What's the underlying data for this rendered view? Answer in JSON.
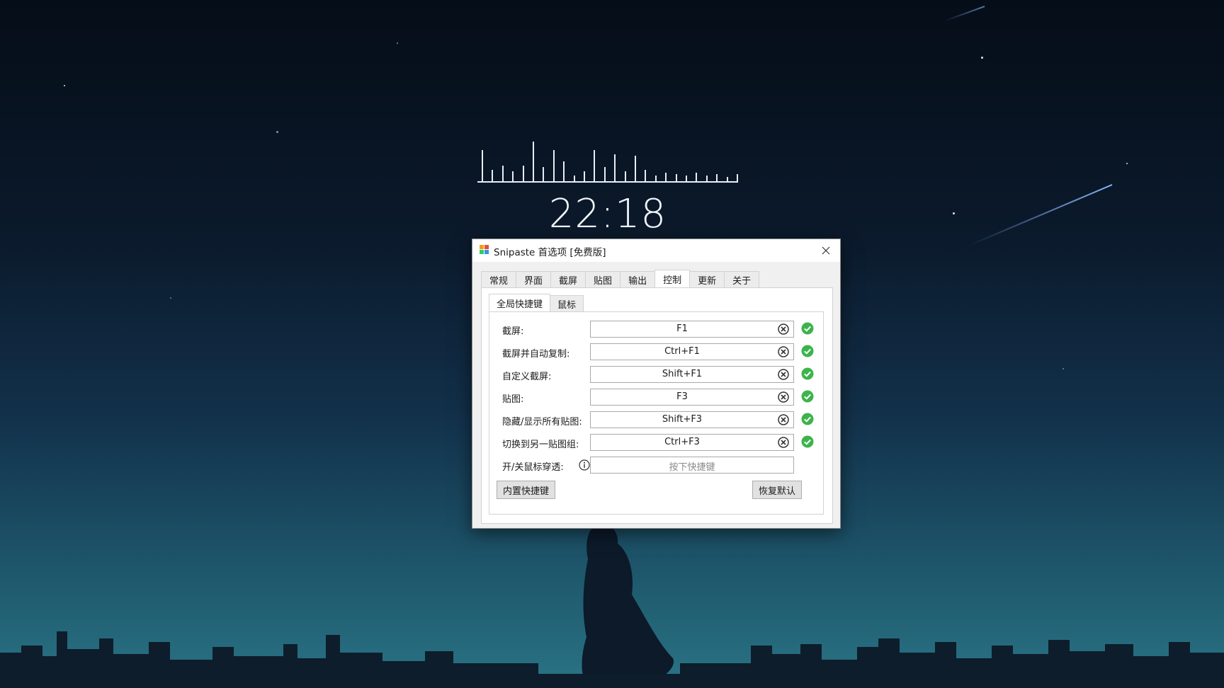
{
  "clock": {
    "time": "22:18"
  },
  "window": {
    "title": "Snipaste 首选项 [免费版]",
    "icon": "snipaste-logo-icon",
    "close_icon": "close-icon"
  },
  "tabs": [
    {
      "label": "常规",
      "active": false
    },
    {
      "label": "界面",
      "active": false
    },
    {
      "label": "截屏",
      "active": false
    },
    {
      "label": "贴图",
      "active": false
    },
    {
      "label": "输出",
      "active": false
    },
    {
      "label": "控制",
      "active": true
    },
    {
      "label": "更新",
      "active": false
    },
    {
      "label": "关于",
      "active": false
    }
  ],
  "subtabs": [
    {
      "label": "全局快捷键",
      "active": true
    },
    {
      "label": "鼠标",
      "active": false
    }
  ],
  "hotkeys": [
    {
      "label": "截屏:",
      "value": "F1",
      "status": "ok"
    },
    {
      "label": "截屏并自动复制:",
      "value": "Ctrl+F1",
      "status": "ok"
    },
    {
      "label": "自定义截屏:",
      "value": "Shift+F1",
      "status": "ok"
    },
    {
      "label": "贴图:",
      "value": "F3",
      "status": "ok"
    },
    {
      "label": "隐藏/显示所有贴图:",
      "value": "Shift+F3",
      "status": "ok"
    },
    {
      "label": "切换到另一贴图组:",
      "value": "Ctrl+F3",
      "status": "ok"
    }
  ],
  "mouse_passthrough": {
    "label": "开/关鼠标穿透:",
    "placeholder": "按下快捷键",
    "info_icon": "info-icon"
  },
  "buttons": {
    "builtin": "内置快捷键",
    "restore": "恢复默认"
  },
  "colors": {
    "ok_green": "#3cb44b",
    "accent": "#0078d7"
  }
}
